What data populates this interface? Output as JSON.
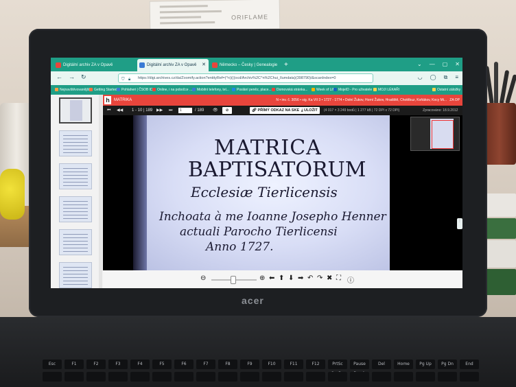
{
  "background": {
    "paper_brand": "ORIFLAME"
  },
  "laptop": {
    "brand": "acer"
  },
  "browser": {
    "tabs": [
      {
        "label": "Digitální archiv ZA v Opavě",
        "active": false,
        "color": "#e8453c"
      },
      {
        "label": "Digitální archiv ZA v Opavě",
        "active": true,
        "color": "#3a7bd5"
      },
      {
        "label": "Německo – Česky | Genealogie",
        "active": false,
        "color": "#e8453c"
      }
    ],
    "new_tab": "+",
    "url": "https://digi.archives.cz/da/Zoomify.action?entityRef=(^n)(((ocd/Archiv%2C^n%2Chui_Ilumdata)(398790)/&scanIndex=0",
    "bookmarks": [
      "Nejnavštěvovanější",
      "Getting Started",
      "Pohlaheri | ČSOB ID",
      "Online, i na pobočce ...",
      "Mobilní telefony, tel...",
      "Poslání peněz, place...",
      "Domovská stránka...",
      "Week of Life",
      "MojeID - Pro uživatele",
      "MOJI LÉKAŘI",
      "Ostatní záložky"
    ]
  },
  "viewer": {
    "header_title": "MATRIKA",
    "header_info": "N • inv. č. 3056 • sig. Ka VII 3 • 1727 - 1774 • Dolní Žukov, Horní Žukov, Hradiště, Chotěbuz, Koňákov, Kocy Mi...",
    "header_code": "ZA OP",
    "page_current": "1",
    "page_of": "1 - 10 | 189",
    "page_total": "/ 189",
    "btn_link": "PŘÍMÝ ODKAZ NA SKEN",
    "btn_save": "ULOŽIT",
    "scan_info": "(4 017 × 3 249 bodů | 1 277 kB | 72 DPI x 72 DPI)",
    "processed": "Zpracováno: 18.9.2012",
    "thumbnail_count": 6
  },
  "document": {
    "line1": "MATRICA",
    "line2": "BAPTISATORUM",
    "line3": "Ecclesiæ Tierlicensis",
    "line4": "Inchoata à me Ioanne Josepho Henner",
    "line5": "actuali Parocho Tierlicensi",
    "line6": "Anno 1727."
  },
  "keyboard": {
    "top_row": [
      "Esc",
      "F1",
      "F2",
      "F3",
      "F4",
      "F5",
      "F6",
      "F7",
      "F8",
      "F9",
      "F10",
      "F11",
      "F12",
      "PrtSc SysRq",
      "Pause Break",
      "Del",
      "Home",
      "Pg Up",
      "Pg Dn",
      "End"
    ]
  }
}
